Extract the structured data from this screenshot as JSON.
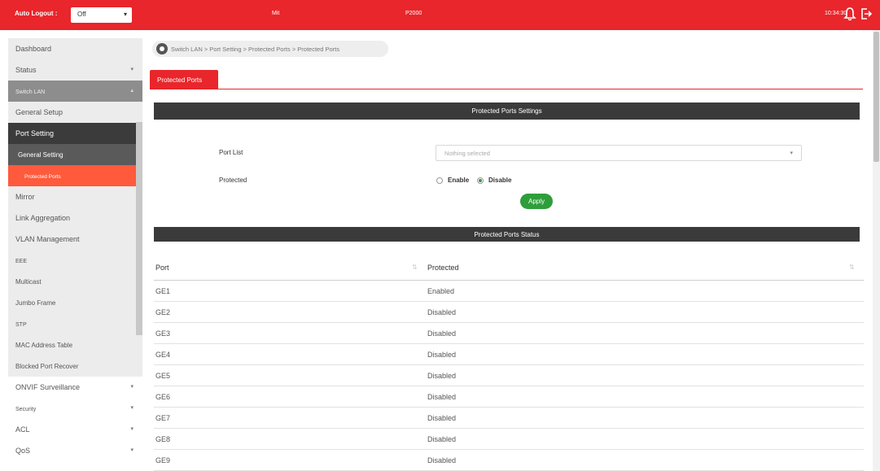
{
  "topbar": {
    "auto_logout_label": "Auto Logout :",
    "auto_logout_value": "Off",
    "model_left": "Mit",
    "model_right": "P2000",
    "clock": "10:34:30"
  },
  "sidebar": {
    "items": [
      {
        "label": "Dashboard"
      },
      {
        "label": "Status"
      },
      {
        "label": "Switch LAN"
      },
      {
        "label": "General Setup"
      },
      {
        "label": "Port Setting"
      },
      {
        "label": "General Setting"
      },
      {
        "label": "Protected Ports"
      },
      {
        "label": "Mirror"
      },
      {
        "label": "Link Aggregation"
      },
      {
        "label": "VLAN Management"
      },
      {
        "label": "EEE"
      },
      {
        "label": "Multicast"
      },
      {
        "label": "Jumbo Frame"
      },
      {
        "label": "STP"
      },
      {
        "label": "MAC Address Table"
      },
      {
        "label": "Blocked Port Recover"
      },
      {
        "label": "ONVIF Surveillance"
      },
      {
        "label": "Security"
      },
      {
        "label": "ACL"
      },
      {
        "label": "QoS"
      }
    ]
  },
  "breadcrumb": "Switch LAN > Port Setting > Protected Ports > Protected Ports",
  "tab": "Protected Ports",
  "settings": {
    "header": "Protected Ports Settings",
    "port_list_label": "Port List",
    "port_list_placeholder": "Nothing selected",
    "protected_label": "Protected",
    "enable_label": "Enable",
    "disable_label": "Disable",
    "apply_label": "Apply"
  },
  "status": {
    "header": "Protected Ports Status",
    "columns": [
      "Port",
      "Protected"
    ],
    "rows": [
      {
        "port": "GE1",
        "protected": "Enabled"
      },
      {
        "port": "GE2",
        "protected": "Disabled"
      },
      {
        "port": "GE3",
        "protected": "Disabled"
      },
      {
        "port": "GE4",
        "protected": "Disabled"
      },
      {
        "port": "GE5",
        "protected": "Disabled"
      },
      {
        "port": "GE6",
        "protected": "Disabled"
      },
      {
        "port": "GE7",
        "protected": "Disabled"
      },
      {
        "port": "GE8",
        "protected": "Disabled"
      },
      {
        "port": "GE9",
        "protected": "Disabled"
      }
    ]
  },
  "colors": {
    "brand_red": "#e8262b",
    "active_orange": "#ff5a3c",
    "apply_green": "#2e9e3a",
    "bar_dark": "#3a3a3a"
  }
}
